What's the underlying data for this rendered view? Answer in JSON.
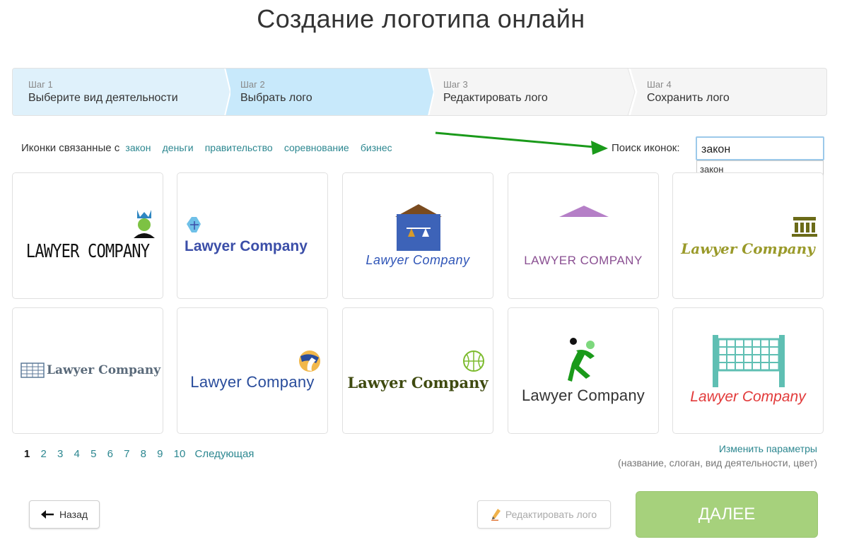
{
  "page": {
    "title": "Создание логотипа онлайн"
  },
  "steps": [
    {
      "num": "Шаг 1",
      "label": "Выберите вид деятельности"
    },
    {
      "num": "Шаг 2",
      "label": "Выбрать лого"
    },
    {
      "num": "Шаг 3",
      "label": "Редактировать лого"
    },
    {
      "num": "Шаг 4",
      "label": "Сохранить лого"
    }
  ],
  "related": {
    "label": "Иконки связанные с",
    "tags": [
      "закон",
      "деньги",
      "правительство",
      "соревнование",
      "бизнес"
    ]
  },
  "search": {
    "label": "Поиск иконок:",
    "value": "закон",
    "suggestion": "закон"
  },
  "logos": [
    {
      "text": "LAWYER COMPANY",
      "color": "#111111",
      "icon": "king-head-icon"
    },
    {
      "text": "Lawyer Company",
      "color": "#3b4ea8",
      "icon": "scales-icon"
    },
    {
      "text": "Lawyer Company",
      "color": "#2f55b7",
      "icon": "scales-house-icon"
    },
    {
      "text": "LAWYER COMPANY",
      "color": "#8a4f92",
      "icon": "roof-icon"
    },
    {
      "text": "Lawyer Company",
      "color": "#9a9a2a",
      "icon": "courthouse-icon"
    },
    {
      "text": "Lawyer Company",
      "color": "#5a6a7a",
      "icon": "volleyball-net-icon"
    },
    {
      "text": "Lawyer Company",
      "color": "#2a4d9c",
      "icon": "volleyball-icon"
    },
    {
      "text": "Lawyer Company",
      "color": "#3f4a10",
      "icon": "basketball-icon"
    },
    {
      "text": "Lawyer Company",
      "color": "#333333",
      "icon": "volleyball-player-icon"
    },
    {
      "text": "Lawyer Company",
      "color": "#e23a3a",
      "icon": "net-icon"
    }
  ],
  "pagination": {
    "pages": [
      "1",
      "2",
      "3",
      "4",
      "5",
      "6",
      "7",
      "8",
      "9",
      "10"
    ],
    "current": "1",
    "next": "Следующая"
  },
  "params": {
    "link": "Изменить параметры",
    "hint": "(название, слоган, вид деятельности, цвет)"
  },
  "buttons": {
    "back": "Назад",
    "edit": "Редактировать лого",
    "next": "ДАЛЕЕ"
  },
  "colors": {
    "link": "#2c8790",
    "step_active": "#c8e9fb",
    "step_done": "#dff1fb",
    "next_button": "#a6d17c",
    "arrow": "#1a9a1a"
  }
}
